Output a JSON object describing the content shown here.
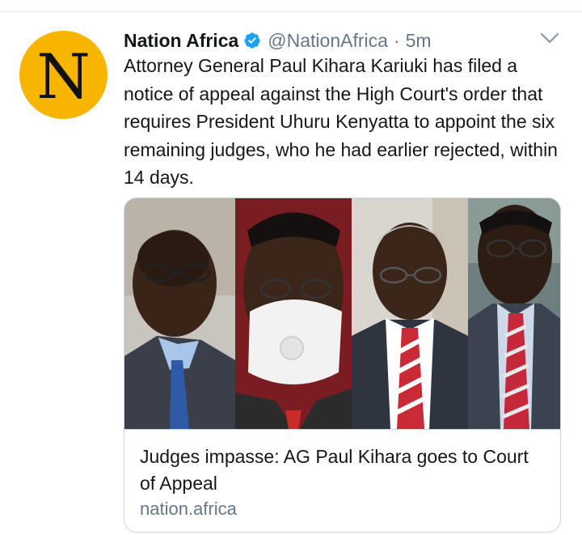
{
  "tweet": {
    "avatar_letter": "N",
    "display_name": "Nation Africa",
    "verified": true,
    "handle": "@NationAfrica",
    "separator": "·",
    "time": "5m",
    "text": "Attorney General Paul Kihara Kariuki has filed a notice of appeal against the High Court's order that requires President Uhuru Kenyatta to appoint the six remaining judges, who he had earlier rejected, within 14 days."
  },
  "card": {
    "title": "Judges impasse: AG Paul Kihara goes to Court of Appeal",
    "domain": "nation.africa"
  },
  "icons": {
    "verified": "verified-badge-icon",
    "menu": "chevron-down-icon"
  },
  "colors": {
    "avatar_bg": "#f7b500",
    "verified_blue": "#1da1f2",
    "secondary_text": "#657786",
    "border": "#ccd6dd"
  }
}
